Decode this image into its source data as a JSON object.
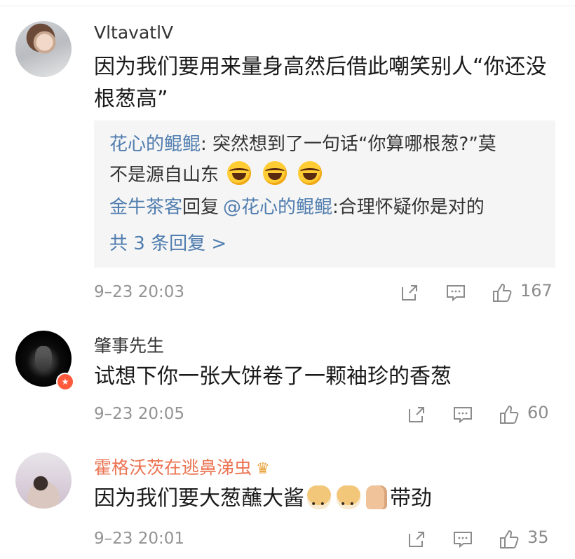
{
  "comments": [
    {
      "username": "VltavatlV",
      "text": "因为我们要用来量身高然后借此嘲笑别人“你还没根葱高”",
      "replies": [
        {
          "author": "花心的鲲鲲",
          "sep": ": ",
          "text": "突然想到了一句话“你算哪根葱?”莫",
          "text2": "不是源自山东"
        },
        {
          "author": "金牛茶客",
          "mid": "回复",
          "mention": "@花心的鲲鲲",
          "text": ":合理怀疑你是对的"
        }
      ],
      "more_replies": "共 3 条回复 >",
      "time": "9–23 20:03",
      "likes": "167"
    },
    {
      "username": "肇事先生",
      "text": "试想下你一张大饼卷了一颗袖珍的香葱",
      "time": "9–23 20:05",
      "likes": "60"
    },
    {
      "username": "霍格沃茨在逃鼻涕虫",
      "text_a": "因为我们要大葱蘸大酱",
      "text_b": "带劲",
      "time": "9–23 20:01",
      "likes": "35"
    }
  ],
  "icons": {
    "share": "share-icon",
    "comment": "comment-icon",
    "like": "thumbs-up-icon",
    "badge": "verified-badge-icon",
    "crown": "crown-icon"
  },
  "colors": {
    "link_blue": "#507daf",
    "gold_name": "#eb7350",
    "meta_gray": "#939393"
  }
}
